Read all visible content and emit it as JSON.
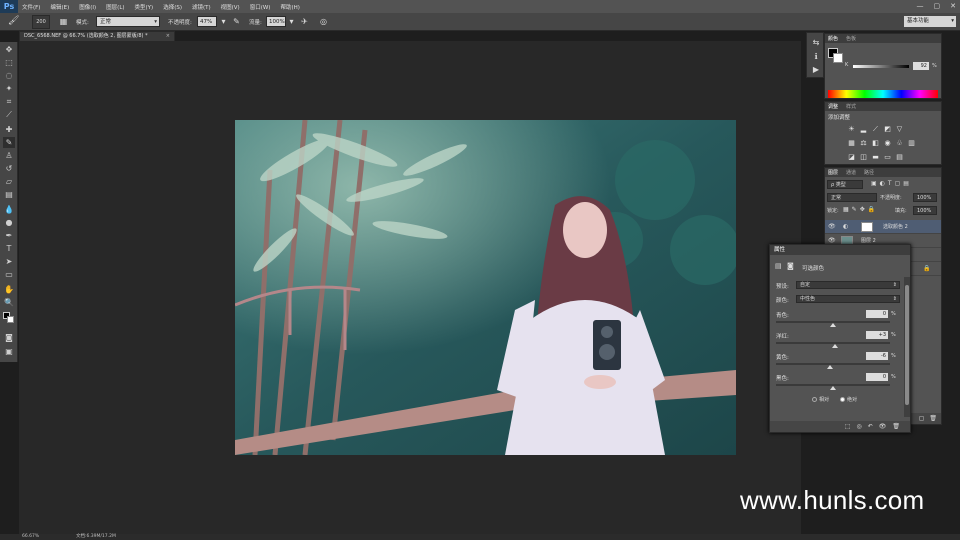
{
  "app": {
    "logo": "Ps"
  },
  "menu": [
    "文件(F)",
    "编辑(E)",
    "图像(I)",
    "图层(L)",
    "类型(Y)",
    "选择(S)",
    "滤镜(T)",
    "视图(V)",
    "窗口(W)",
    "帮助(H)"
  ],
  "window_controls": [
    "—",
    "▢",
    "✕"
  ],
  "options_bar": {
    "brush_size": "200",
    "mode_label": "模式:",
    "mode_value": "正常",
    "opacity_label": "不透明度:",
    "opacity_value": "47%",
    "flow_label": "流量:",
    "flow_value": "100%",
    "workspace": "基本功能"
  },
  "document_tab": {
    "title": "DSC_6568.NEF @ 66.7% (选取颜色 2, 图层蒙版/8) *",
    "close": "×"
  },
  "status_bar": {
    "zoom": "66.67%",
    "doc": "文档:6.39M/17.2M"
  },
  "color_panel": {
    "tabs": [
      "颜色",
      "色板"
    ],
    "k_label": "K",
    "k_value": "92",
    "k_unit": "%"
  },
  "adjustments_panel": {
    "tabs": [
      "调整",
      "样式"
    ],
    "heading": "添加调整"
  },
  "layers_panel": {
    "tabs": [
      "图层",
      "通道",
      "路径"
    ],
    "kind_filter": "ρ 类型",
    "blend_mode": "正常",
    "opacity_label": "不透明度:",
    "opacity_value": "100%",
    "lock_label": "锁定:",
    "fill_label": "填充:",
    "fill_value": "100%",
    "layers": [
      {
        "name": "选取颜色 2",
        "selected": true
      },
      {
        "name": "图层 2",
        "selected": false
      },
      {
        "name": "",
        "selected": false
      },
      {
        "name": "",
        "selected": false
      }
    ]
  },
  "properties_panel": {
    "title": "属性",
    "subtitle": "可选颜色",
    "preset_label": "预设:",
    "preset_value": "自定",
    "colors_label": "颜色:",
    "colors_value": "中性色",
    "sliders": [
      {
        "label": "青色:",
        "value": "0",
        "unit": "%",
        "pos": 0.5
      },
      {
        "label": "洋红:",
        "value": "+3",
        "unit": "%",
        "pos": 0.515
      },
      {
        "label": "黄色:",
        "value": "-6",
        "unit": "%",
        "pos": 0.47
      },
      {
        "label": "黑色:",
        "value": "0",
        "unit": "%",
        "pos": 0.5
      }
    ],
    "radio_relative": "相对",
    "radio_absolute": "绝对"
  },
  "watermark": "www.hunls.com",
  "colors": {
    "ui_dark": "#282828",
    "panel": "#535353",
    "selected_layer": "#4f5d73",
    "accent_blue": "#6fb3ff"
  }
}
